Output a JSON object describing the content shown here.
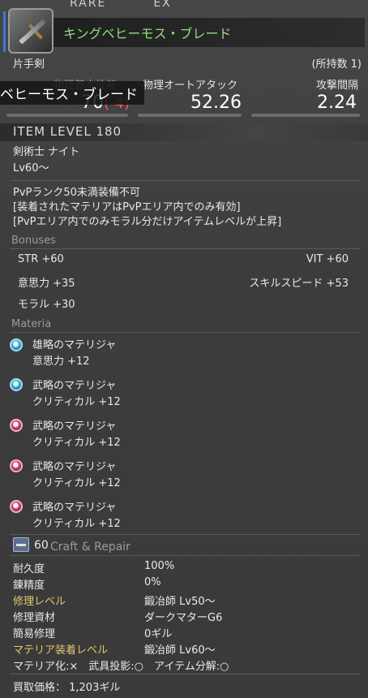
{
  "header": {
    "tag_rarity": "RARE",
    "tag_ex": "EX",
    "item_name": "キングベヒーモス・ブレード",
    "overlay_name": "ベヒーモス・ブレード",
    "category": "片手剣",
    "owned_count": "(所持数 1)"
  },
  "stats": {
    "phys_label": "物理基本性能",
    "phys_value": "70",
    "phys_diff": "(-4)",
    "auto_label": "物理オートアタック",
    "auto_value": "52.26",
    "delay_label": "攻撃間隔",
    "delay_value": "2.24"
  },
  "item_level": "ITEM LEVEL 180",
  "classes": "剣術士 ナイト",
  "level_req": "Lv60～",
  "restrictions": [
    "PvPランク50未満装備不可",
    "[装着されたマテリアはPvPエリア内でのみ有効]",
    "[PvPエリア内でのみモラル分だけアイテムレベルが上昇]"
  ],
  "bonuses": {
    "header": "Bonuses",
    "items": [
      "STR +60",
      "VIT +60",
      "意思力 +35",
      "スキルスピード +53",
      "モラル +30"
    ]
  },
  "materia": {
    "header": "Materia",
    "items": [
      {
        "name": "雄略のマテリジャ",
        "effect": "意思力 +12",
        "color": "#4fb8d8"
      },
      {
        "name": "武略のマテリジャ",
        "effect": "クリティカル +12",
        "color": "#4fb8d8"
      },
      {
        "name": "武略のマテリジャ",
        "effect": "クリティカル +12",
        "color": "#d8507a"
      },
      {
        "name": "武略のマテリジャ",
        "effect": "クリティカル +12",
        "color": "#d8507a"
      },
      {
        "name": "武略のマテリジャ",
        "effect": "クリティカル +12",
        "color": "#d8507a"
      }
    ]
  },
  "craft": {
    "level": "60",
    "header": "Craft & Repair",
    "rows": [
      {
        "label": "耐久度",
        "value": "100%"
      },
      {
        "label": "錬精度",
        "value": "0%"
      },
      {
        "label": "修理レベル",
        "value": "鍛冶師 Lv50～"
      },
      {
        "label": "修理資材",
        "value": "ダークマターG6"
      },
      {
        "label": "簡易修理",
        "value": "0ギル"
      },
      {
        "label": "マテリア装着レベル",
        "value": "鍛冶師 Lv60～"
      }
    ],
    "flags": "マテリア化:×　武具投影:○　アイテム分解:○",
    "sell_price": "買取価格： 1,203ギル"
  },
  "colors": {
    "name_green": "#8ee07a",
    "label_yellow": "#e0c870",
    "label_white": "#e8e8e8",
    "negative_red": "#ff5a5a"
  }
}
